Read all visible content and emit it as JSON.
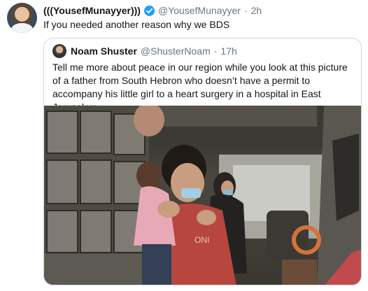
{
  "tweet": {
    "display_name": "(((YousefMunayyer)))",
    "handle": "@YousefMunayyer",
    "separator": "·",
    "time": "2h",
    "text": "If you needed another reason why we BDS"
  },
  "quoted_tweet": {
    "display_name": "Noam Shuster",
    "handle": "@ShusterNoam",
    "separator": "·",
    "time": "17h",
    "text": "Tell me more about peace in our region while you look at this picture of a father from South Hebron who doesn’t have a permit to accompany his little girl to a heart surgery in a hospital in East Jerusalem."
  },
  "icons": {
    "verified": "verified-badge-icon"
  },
  "colors": {
    "accent": "#1da1f2",
    "secondary_text": "#657786",
    "border": "#ccd6dd"
  }
}
